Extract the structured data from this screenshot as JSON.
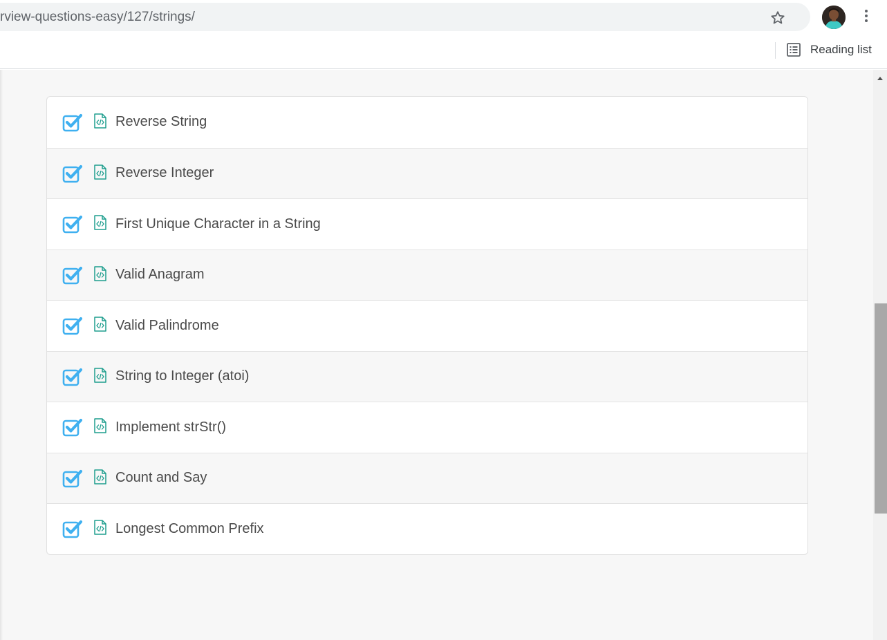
{
  "browser": {
    "url": "rview-questions-easy/127/strings/",
    "reading_list_label": "Reading list"
  },
  "problems": [
    {
      "title": "Reverse String",
      "completed": true
    },
    {
      "title": "Reverse Integer",
      "completed": true
    },
    {
      "title": "First Unique Character in a String",
      "completed": true
    },
    {
      "title": "Valid Anagram",
      "completed": true
    },
    {
      "title": "Valid Palindrome",
      "completed": true
    },
    {
      "title": "String to Integer (atoi)",
      "completed": true
    },
    {
      "title": "Implement strStr()",
      "completed": true
    },
    {
      "title": "Count and Say",
      "completed": true
    },
    {
      "title": "Longest Common Prefix",
      "completed": true
    }
  ],
  "colors": {
    "check": "#3fb0f0",
    "code_icon": "#1e9e8e",
    "title_text": "#4a4a4a"
  }
}
